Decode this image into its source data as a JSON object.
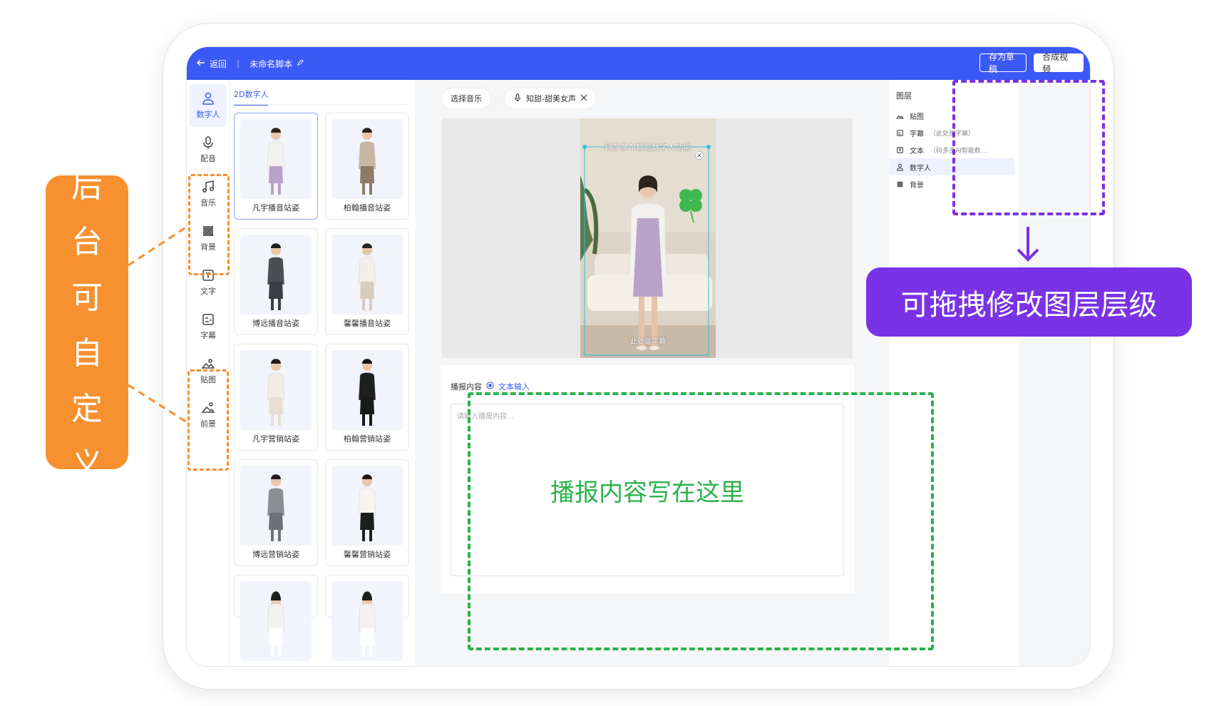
{
  "topbar": {
    "back_label": "返回",
    "separator": "|",
    "title": "未命名脚本",
    "save_draft": "存为草稿",
    "compose_video": "合成视频"
  },
  "rail": {
    "items": [
      {
        "label": "数字人",
        "icon": "person-icon"
      },
      {
        "label": "配音",
        "icon": "microphone-icon"
      },
      {
        "label": "音乐",
        "icon": "music-note-icon"
      },
      {
        "label": "背景",
        "icon": "background-pattern-icon"
      },
      {
        "label": "文字",
        "icon": "text-box-icon"
      },
      {
        "label": "字幕",
        "icon": "subtitle-icon"
      },
      {
        "label": "贴图",
        "icon": "sticker-icon"
      },
      {
        "label": "前景",
        "icon": "foreground-icon"
      }
    ]
  },
  "panel": {
    "tab": "2D数字人",
    "cards": [
      {
        "label": "凡宇播音站姿"
      },
      {
        "label": "柏翰播音站姿"
      },
      {
        "label": "博远播音站姿"
      },
      {
        "label": "馨馨播音站姿"
      },
      {
        "label": "凡宇营销站姿"
      },
      {
        "label": "柏翰营销站姿"
      },
      {
        "label": "博远营销站姿"
      },
      {
        "label": "馨馨营销站姿"
      },
      {
        "label": ""
      },
      {
        "label": ""
      }
    ]
  },
  "center": {
    "music_chip": "选择音乐",
    "voice_chip": "知甜-甜美女声",
    "preview_title": "码多多AI智能数字人功能",
    "preview_subtitle": "此处是字幕",
    "content_label": "播报内容",
    "radio_label": "文本输入",
    "placeholder": "请输入播报内容...",
    "overlay_hint": "播报内容写在这里"
  },
  "layers": {
    "title": "图层",
    "items": [
      {
        "name": "贴图",
        "sub": "",
        "icon": "sticker-icon"
      },
      {
        "name": "字幕",
        "sub": "（此处是字幕）",
        "icon": "subtitle-icon"
      },
      {
        "name": "文本",
        "sub": "（码多多AI智能数...",
        "icon": "text-box-icon"
      },
      {
        "name": "数字人",
        "sub": "",
        "icon": "person-icon"
      },
      {
        "name": "背景",
        "sub": "",
        "icon": "background-square-icon"
      }
    ]
  },
  "annotations": {
    "left_chars": [
      "后",
      "台",
      "可",
      "自",
      "定",
      "义"
    ],
    "right_text": "可拖拽修改图层层级"
  },
  "colors": {
    "brand_blue": "#3b59f5",
    "annotation_orange": "#f7902e",
    "annotation_green": "#2bb24c",
    "annotation_purple": "#7a32e6"
  }
}
